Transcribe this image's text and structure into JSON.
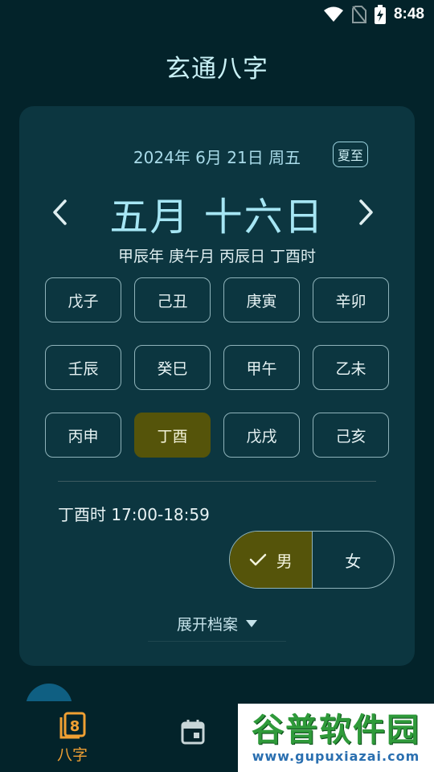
{
  "status_bar": {
    "time": "8:48"
  },
  "app": {
    "title": "玄通八字"
  },
  "date_card": {
    "solar_date": "2024年 6月 21日 周五",
    "solar_term": "夏至",
    "lunar_date": "五月 十六日",
    "ganzhi": "甲辰年 庚午月 丙辰日 丁酉时",
    "hours": [
      "戊子",
      "己丑",
      "庚寅",
      "辛卯",
      "壬辰",
      "癸巳",
      "甲午",
      "乙未",
      "丙申",
      "丁酉",
      "戊戌",
      "己亥"
    ],
    "selected_hour": "丁酉",
    "hour_range": "丁酉时 17:00-18:59",
    "gender": {
      "male": "男",
      "female": "女",
      "selected": "男"
    },
    "expand_label": "展开档案"
  },
  "bottom_nav": {
    "items": [
      {
        "label": "八字",
        "icon": "bazi-icon",
        "active": true
      },
      {
        "label": "",
        "icon": "calendar-icon",
        "active": false
      }
    ]
  },
  "watermark": {
    "text": "谷普软件园",
    "url": "www.gupuxiazai.com"
  },
  "colors": {
    "background": "#03232a",
    "card": "#0c3640",
    "accent_selected": "#55540a",
    "nav_active": "#f0a033",
    "lunar_text": "#a6e6f4"
  }
}
